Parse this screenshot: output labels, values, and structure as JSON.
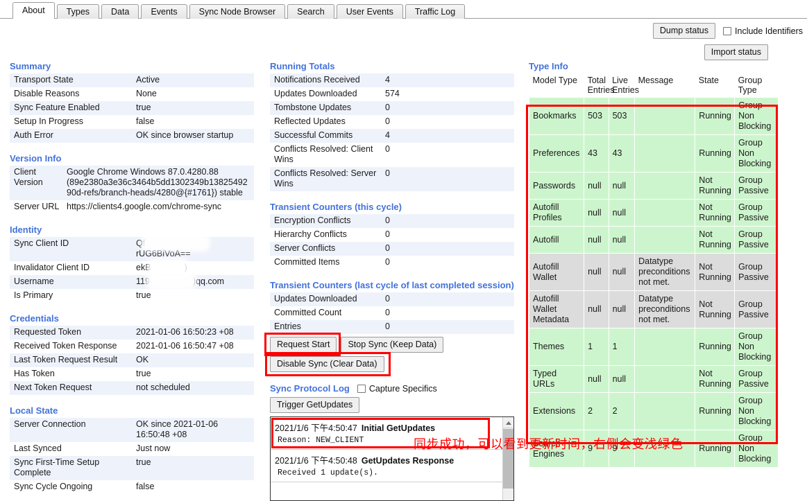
{
  "tabs": [
    {
      "label": "About",
      "active": true
    },
    {
      "label": "Types",
      "active": false
    },
    {
      "label": "Data",
      "active": false
    },
    {
      "label": "Events",
      "active": false
    },
    {
      "label": "Sync Node Browser",
      "active": false
    },
    {
      "label": "Search",
      "active": false
    },
    {
      "label": "User Events",
      "active": false
    },
    {
      "label": "Traffic Log",
      "active": false
    }
  ],
  "toolbar": {
    "dump_status_label": "Dump status",
    "include_identifiers_label": "Include Identifiers",
    "import_status_label": "Import status"
  },
  "summary": {
    "title": "Summary",
    "rows": [
      {
        "key": "Transport State",
        "value": "Active"
      },
      {
        "key": "Disable Reasons",
        "value": "None"
      },
      {
        "key": "Sync Feature Enabled",
        "value": "true"
      },
      {
        "key": "Setup In Progress",
        "value": "false"
      },
      {
        "key": "Auth Error",
        "value": "OK since browser startup"
      }
    ]
  },
  "version_info": {
    "title": "Version Info",
    "rows": [
      {
        "key": "Client Version",
        "value": "Google Chrome Windows 87.0.4280.88 (89e2380a3e36c3464b5dd1302349b1382549290d-refs/branch-heads/4280@{#1761}) stable"
      },
      {
        "key": "Server URL",
        "value": "https://clients4.google.com/chrome-sync"
      }
    ]
  },
  "identity": {
    "title": "Identity",
    "rows": [
      {
        "key": "Sync Client ID",
        "prefix": "Qf",
        "suffix": "rUG6BiVoA==",
        "redacted": true
      },
      {
        "key": "Invalidator Client ID",
        "prefix": "ekB",
        "suffix": ")",
        "redacted": true
      },
      {
        "key": "Username",
        "prefix": "119",
        "suffix": ")qq.com",
        "redacted": true
      },
      {
        "key": "Is Primary",
        "value": "true"
      }
    ]
  },
  "credentials": {
    "title": "Credentials",
    "rows": [
      {
        "key": "Requested Token",
        "value": "2021-01-06 16:50:23 +08"
      },
      {
        "key": "Received Token Response",
        "value": "2021-01-06 16:50:47 +08"
      },
      {
        "key": "Last Token Request Result",
        "value": "OK"
      },
      {
        "key": "Has Token",
        "value": "true"
      },
      {
        "key": "Next Token Request",
        "value": "not scheduled"
      }
    ]
  },
  "local_state": {
    "title": "Local State",
    "rows": [
      {
        "key": "Server Connection",
        "value": "OK since 2021-01-06 16:50:48 +08"
      },
      {
        "key": "Last Synced",
        "value": "Just now"
      },
      {
        "key": "Sync First-Time Setup Complete",
        "value": "true"
      },
      {
        "key": "Sync Cycle Ongoing",
        "value": "false"
      }
    ]
  },
  "running_totals": {
    "title": "Running Totals",
    "rows": [
      {
        "key": "Notifications Received",
        "value": "4"
      },
      {
        "key": "Updates Downloaded",
        "value": "574"
      },
      {
        "key": "Tombstone Updates",
        "value": "0"
      },
      {
        "key": "Reflected Updates",
        "value": "0"
      },
      {
        "key": "Successful Commits",
        "value": "4"
      },
      {
        "key": "Conflicts Resolved: Client Wins",
        "value": "0"
      },
      {
        "key": "Conflicts Resolved: Server Wins",
        "value": "0"
      }
    ]
  },
  "transient_this_cycle": {
    "title": "Transient Counters (this cycle)",
    "rows": [
      {
        "key": "Encryption Conflicts",
        "value": "0"
      },
      {
        "key": "Hierarchy Conflicts",
        "value": "0"
      },
      {
        "key": "Server Conflicts",
        "value": "0"
      },
      {
        "key": "Committed Items",
        "value": "0"
      }
    ]
  },
  "transient_last_cycle": {
    "title": "Transient Counters (last cycle of last completed session)",
    "rows": [
      {
        "key": "Updates Downloaded",
        "value": "0"
      },
      {
        "key": "Committed Count",
        "value": "0"
      },
      {
        "key": "Entries",
        "value": "0"
      }
    ]
  },
  "sync_actions": {
    "request_start_label": "Request Start",
    "stop_sync_label": "Stop Sync (Keep Data)",
    "disable_sync_label": "Disable Sync (Clear Data)"
  },
  "protocol_log": {
    "title": "Sync Protocol Log",
    "capture_specifics_label": "Capture Specifics",
    "trigger_label": "Trigger GetUpdates",
    "entries": [
      {
        "timestamp": "2021/1/6 下午4:50:47",
        "title": "Initial GetUpdates",
        "detail": "Reason: NEW_CLIENT",
        "highlighted": true
      },
      {
        "timestamp": "2021/1/6 下午4:50:48",
        "title": "GetUpdates Response",
        "detail": "Received 1 update(s).",
        "highlighted": false
      }
    ]
  },
  "type_info": {
    "title": "Type Info",
    "columns": [
      "Model Type",
      "Total Entries",
      "Live Entries",
      "Message",
      "State",
      "Group Type"
    ],
    "rows": [
      {
        "model_type": "Bookmarks",
        "total": "503",
        "live": "503",
        "message": "",
        "state": "Running",
        "group_type": "Group Non Blocking",
        "status": "green"
      },
      {
        "model_type": "Preferences",
        "total": "43",
        "live": "43",
        "message": "",
        "state": "Running",
        "group_type": "Group Non Blocking",
        "status": "green"
      },
      {
        "model_type": "Passwords",
        "total": "null",
        "live": "null",
        "message": "",
        "state": "Not Running",
        "group_type": "Group Passive",
        "status": "green"
      },
      {
        "model_type": "Autofill Profiles",
        "total": "null",
        "live": "null",
        "message": "",
        "state": "Not Running",
        "group_type": "Group Passive",
        "status": "green"
      },
      {
        "model_type": "Autofill",
        "total": "null",
        "live": "null",
        "message": "",
        "state": "Not Running",
        "group_type": "Group Passive",
        "status": "green"
      },
      {
        "model_type": "Autofill Wallet",
        "total": "null",
        "live": "null",
        "message": "Datatype preconditions not met.",
        "state": "Not Running",
        "group_type": "Group Passive",
        "status": "gray"
      },
      {
        "model_type": "Autofill Wallet Metadata",
        "total": "null",
        "live": "null",
        "message": "Datatype preconditions not met.",
        "state": "Not Running",
        "group_type": "Group Passive",
        "status": "gray"
      },
      {
        "model_type": "Themes",
        "total": "1",
        "live": "1",
        "message": "",
        "state": "Running",
        "group_type": "Group Non Blocking",
        "status": "green"
      },
      {
        "model_type": "Typed URLs",
        "total": "null",
        "live": "null",
        "message": "",
        "state": "Not Running",
        "group_type": "Group Passive",
        "status": "green"
      },
      {
        "model_type": "Extensions",
        "total": "2",
        "live": "2",
        "message": "",
        "state": "Running",
        "group_type": "Group Non Blocking",
        "status": "green"
      },
      {
        "model_type": "Search Engines",
        "total": "9",
        "live": "9",
        "message": "",
        "state": "Running",
        "group_type": "Group Non Blocking",
        "status": "green"
      }
    ]
  },
  "annotation": {
    "chinese_note": "同步成功，可以看到更新时间，右侧会变浅绿色",
    "color": "#ff0000"
  },
  "colors": {
    "section_heading": "#4272db",
    "row_stripe": "#eef2fb",
    "green_row": "#cdf5cd",
    "gray_row": "#dcdcdc",
    "annotation_red": "#ff0000"
  }
}
